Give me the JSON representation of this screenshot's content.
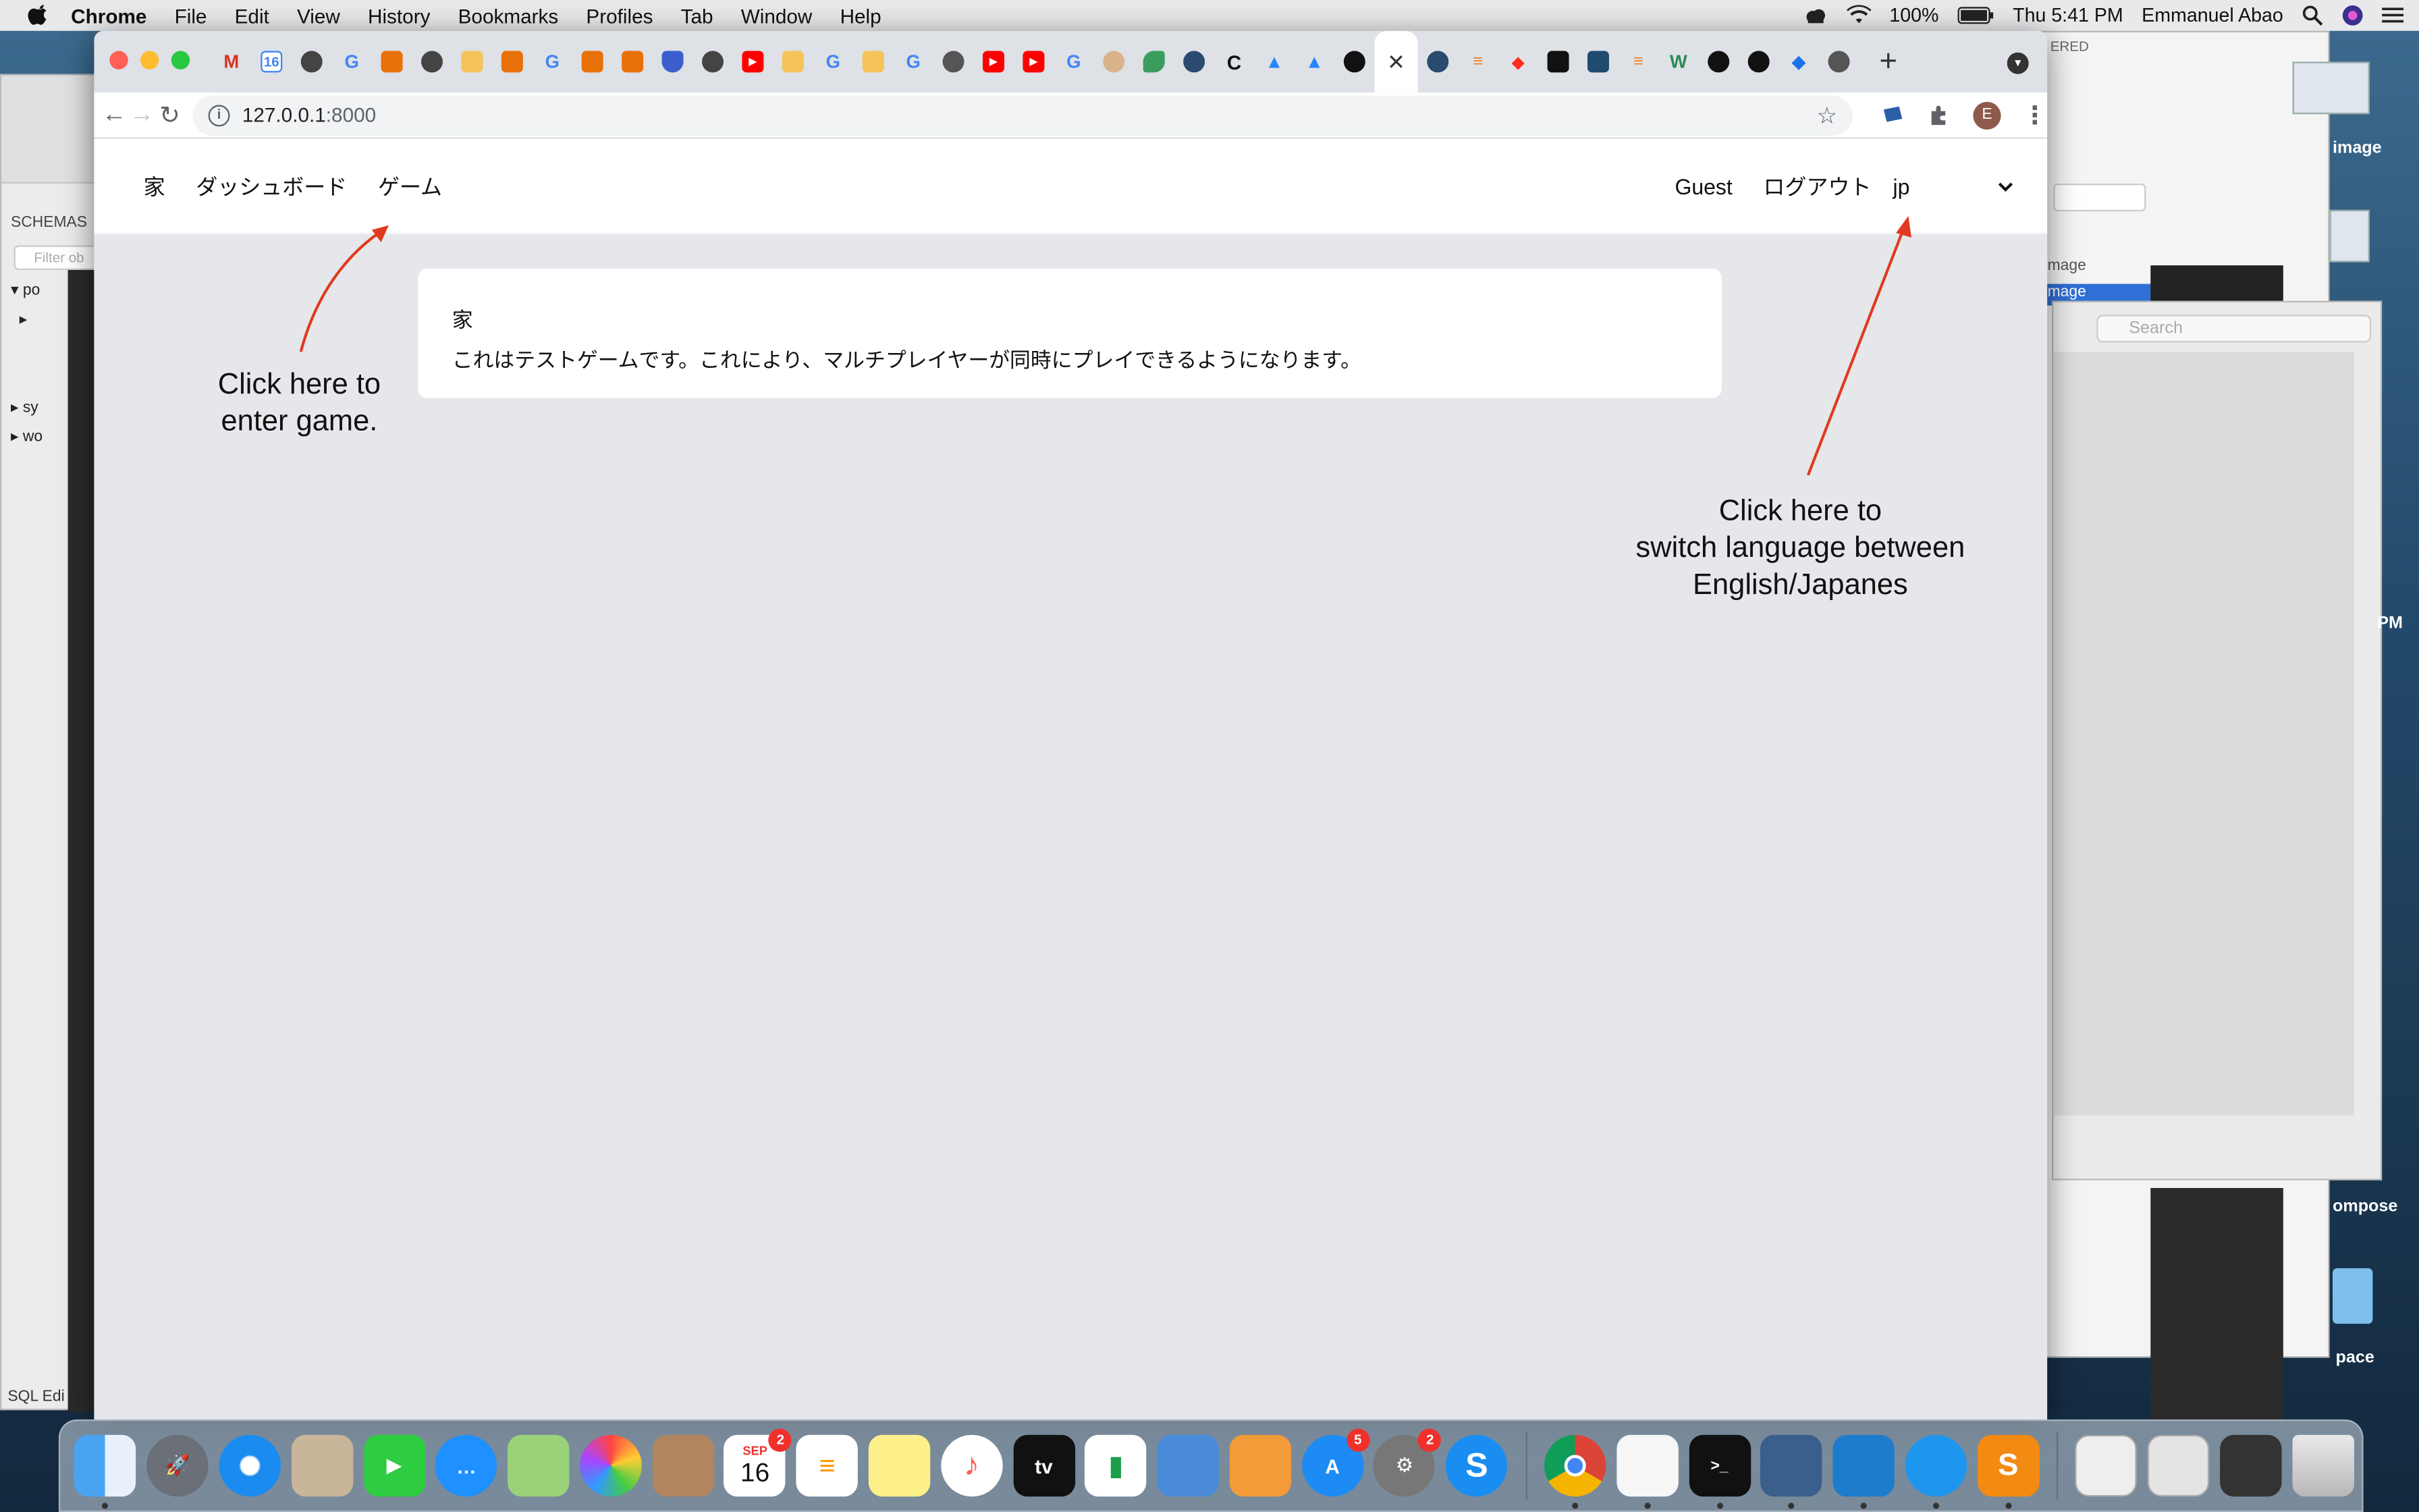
{
  "menubar": {
    "app": "Chrome",
    "items": [
      "File",
      "Edit",
      "View",
      "History",
      "Bookmarks",
      "Profiles",
      "Tab",
      "Window",
      "Help"
    ],
    "battery": "100%",
    "clock": "Thu 5:41 PM",
    "user": "Emmanuel Abao"
  },
  "bg_windows": {
    "left_schemas": "SCHEMAS",
    "left_filter": "Filter ob",
    "left_tree": [
      "po",
      "sy",
      "wo"
    ],
    "left_status": "SQL Edi",
    "right_search": "Search",
    "right_labels": [
      "image",
      "image"
    ],
    "right_header": "ERED",
    "desktop_labels": [
      "image",
      "PM",
      "ompose",
      "pace"
    ]
  },
  "browser": {
    "url_host": "127.0.0.1",
    "url_port": ":8000",
    "profile_initial": "E",
    "tab_count_label": "16"
  },
  "page": {
    "nav": {
      "home": "家",
      "dashboard": "ダッシュボード",
      "game": "ゲーム",
      "user": "Guest",
      "logout": "ログアウト",
      "language": "jp"
    },
    "card": {
      "title": "家",
      "body": "これはテストゲームです。これにより、マルチプレイヤーが同時にプレイできるようになります。"
    }
  },
  "annotations": {
    "game": [
      "Click here to",
      "enter game."
    ],
    "language": [
      "Click here to",
      "switch language between",
      "English/Japanes"
    ]
  },
  "annotation_color": "#e03a20",
  "dock": {
    "calendar_month": "SEP",
    "calendar_day": "16",
    "badges": {
      "calendar": "2",
      "appstore": "5",
      "settings": "2"
    },
    "tv_label": "tv"
  }
}
